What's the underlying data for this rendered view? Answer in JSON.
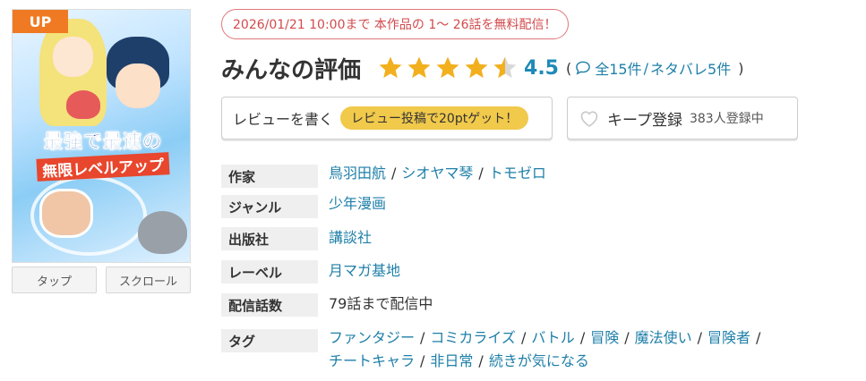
{
  "cover": {
    "badge": "UP",
    "title_line1": "最強で最速の",
    "title_line2": "無限レベルアップ",
    "buttons": [
      "タップ",
      "スクロール"
    ]
  },
  "notice": "2026/01/21 10:00まで 本作品の 1～ 26話を無料配信！",
  "rating": {
    "heading": "みんなの評価",
    "score": "4.5",
    "score_value": 4.5,
    "star_color": "#f2b01e",
    "open_paren": "(",
    "total": "全15件",
    "slash": "/",
    "spoilers": "ネタバレ5件",
    "close_paren": ")"
  },
  "actions": {
    "review_label": "レビューを書く",
    "review_promo": "レビュー投稿で20ptゲット！",
    "keep_label": "キープ登録",
    "keep_count": "383人登録中"
  },
  "info": {
    "author": {
      "label": "作家",
      "values": [
        "鳥羽田航",
        "シオヤマ琴",
        "トモゼロ"
      ]
    },
    "genre": {
      "label": "ジャンル",
      "value": "少年漫画"
    },
    "publisher": {
      "label": "出版社",
      "value": "講談社"
    },
    "label": {
      "label": "レーベル",
      "value": "月マガ基地"
    },
    "episodes": {
      "label": "配信話数",
      "value": "79話まで配信中"
    },
    "tags": {
      "label": "タグ",
      "line1": [
        "ファンタジー",
        "コミカライズ",
        "バトル",
        "冒険",
        "魔法使い",
        "冒険者"
      ],
      "line2": [
        "チートキャラ",
        "非日常",
        "続きが気になる"
      ]
    }
  }
}
